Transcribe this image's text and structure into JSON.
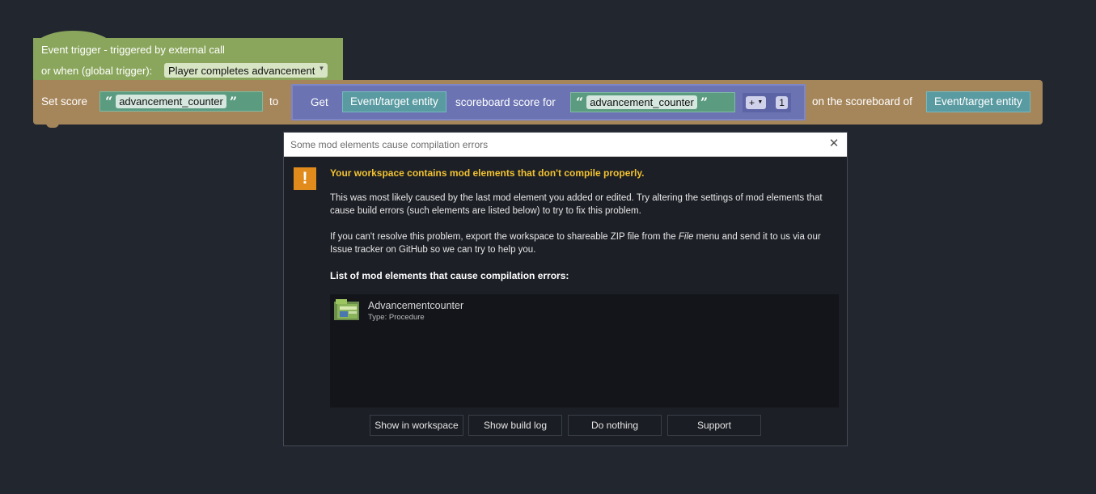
{
  "workspace": {
    "trigger": {
      "line1": "Event trigger - triggered by external call",
      "line2": "or when (global trigger):",
      "dropdown_value": "Player completes advancement",
      "color": "#8aa65c"
    },
    "setscore": {
      "set_label": "Set score",
      "text_value": "advancement_counter",
      "to_label": "to",
      "get_label": "Get",
      "entity_label": "Event/target entity",
      "scoreboard_label": "scoreboard score for",
      "inner_text_value": "advancement_counter",
      "op": "+",
      "number": "1",
      "on_label": "on the scoreboard of",
      "target_entity_label": "Event/target entity",
      "color": "#a5855a"
    }
  },
  "dialog": {
    "title": "Some mod elements cause compilation errors",
    "headline": "Your workspace contains mod elements that don't compile properly.",
    "para1": "This was most likely caused by the last mod element you added or edited. Try altering the settings of mod elements that cause build errors (such elements are listed below) to try to fix this problem.",
    "para2_before": "If you can't resolve this problem, export the workspace to shareable ZIP file from the ",
    "para2_em": "File",
    "para2_after": " menu and send it to us via our Issue tracker on GitHub so we can try to help you.",
    "list_title": "List of mod elements that cause compilation errors:",
    "items": [
      {
        "name": "Advancementcounter",
        "type": "Type: Procedure",
        "icon": "procedure-icon"
      }
    ],
    "buttons": {
      "show_in_workspace": "Show in workspace",
      "show_build_log": "Show build log",
      "do_nothing": "Do nothing",
      "support": "Support"
    },
    "warning_icon": "exclamation-icon",
    "accent": "#f2c230"
  }
}
